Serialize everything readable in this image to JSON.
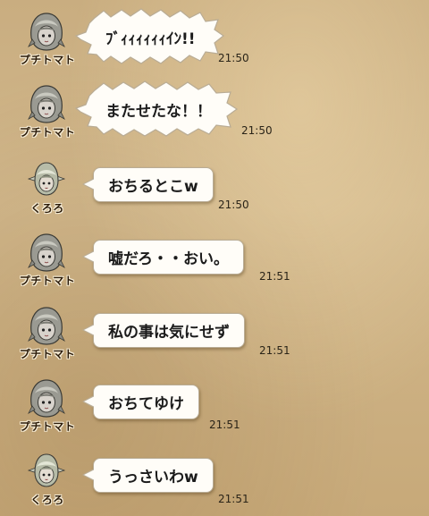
{
  "messages": [
    {
      "sender": "プチトマト",
      "text": "ﾌﾞｨｨｨｨｨｨｲﾝ!!",
      "time": "21:50",
      "avatar": "tomato-avatar",
      "style": "shout"
    },
    {
      "sender": "プチトマト",
      "text": "またせたな！！",
      "time": "21:50",
      "avatar": "tomato-avatar",
      "style": "shout"
    },
    {
      "sender": "くろろ",
      "text": "おちるとこw",
      "time": "21:50",
      "avatar": "kuroro-avatar",
      "style": "normal"
    },
    {
      "sender": "プチトマト",
      "text": "嘘だろ・・おい。",
      "time": "21:51",
      "avatar": "tomato-avatar",
      "style": "normal"
    },
    {
      "sender": "プチトマト",
      "text": "私の事は気にせず",
      "time": "21:51",
      "avatar": "tomato-avatar",
      "style": "normal"
    },
    {
      "sender": "プチトマト",
      "text": "おちてゆけ",
      "time": "21:51",
      "avatar": "tomato-avatar",
      "style": "normal"
    },
    {
      "sender": "くろろ",
      "text": "うっさいわw",
      "time": "21:51",
      "avatar": "kuroro-avatar",
      "style": "normal"
    }
  ]
}
